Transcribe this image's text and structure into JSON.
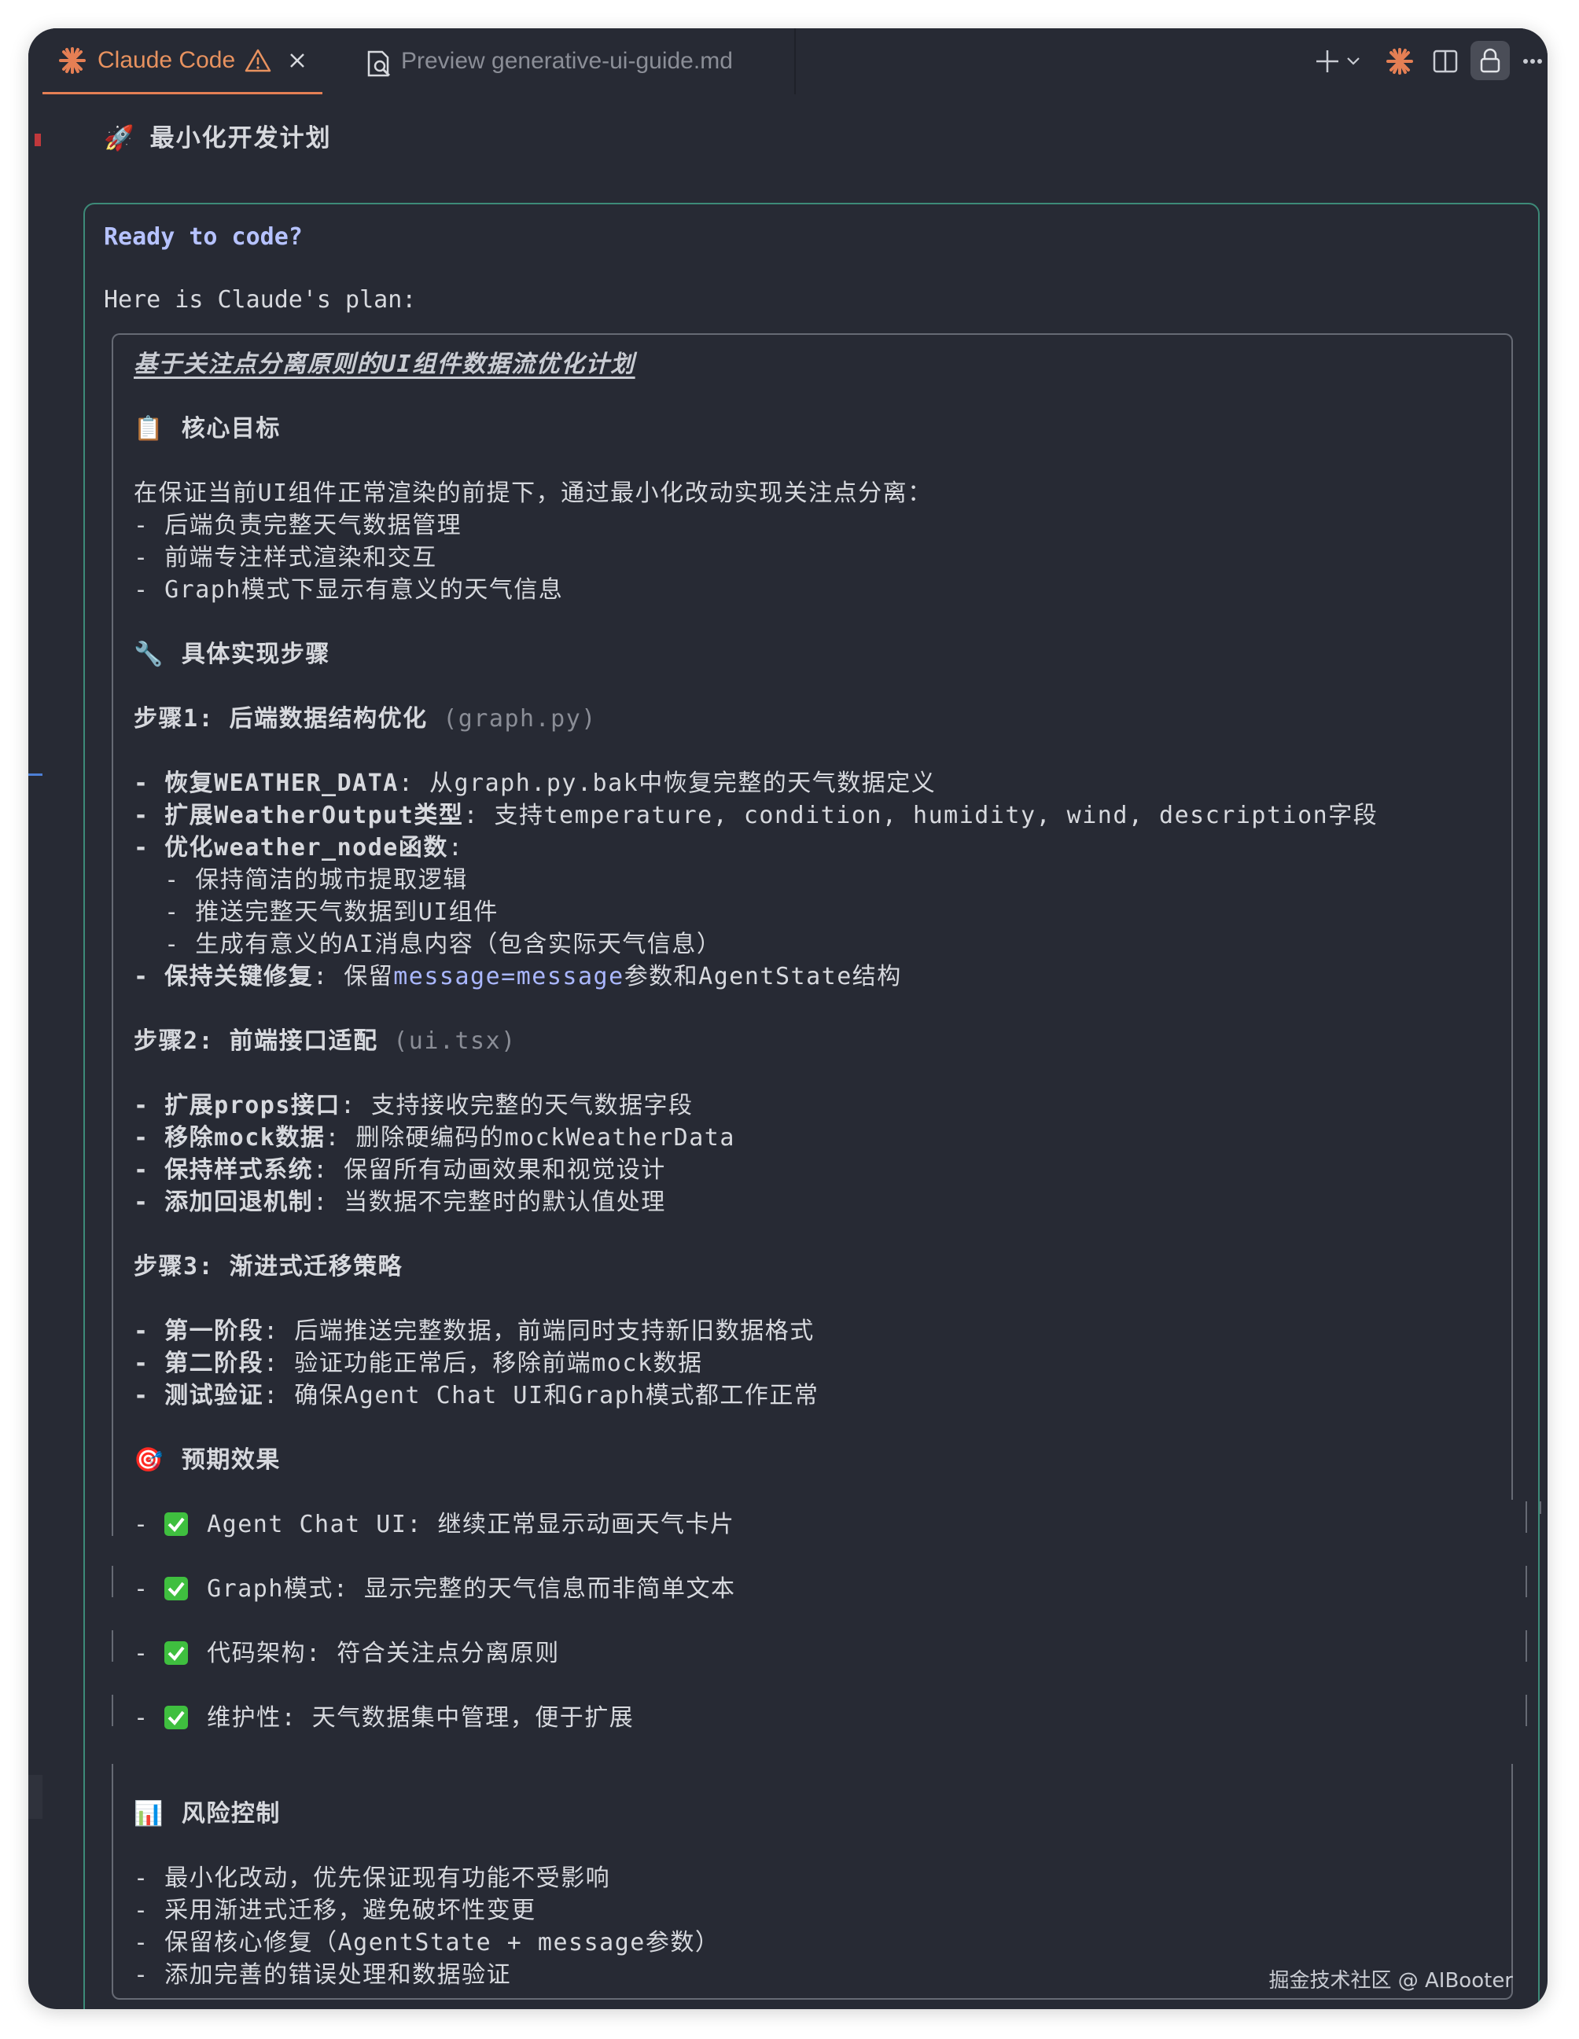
{
  "tabs": [
    {
      "label": "Claude Code",
      "icon": "claude-spark-icon",
      "warning_icon": "warning-icon",
      "close_icon": "close-icon"
    },
    {
      "label": "Preview generative-ui-guide.md",
      "icon": "markdown-preview-icon"
    }
  ],
  "toolbar": {
    "icons": [
      "plus-icon",
      "chevron-down-icon",
      "claude-spark-icon",
      "split-editor-icon",
      "lock-icon",
      "more-icon"
    ]
  },
  "header": {
    "emoji": "🚀",
    "title": "最小化开发计划"
  },
  "prompt": {
    "ready": "Ready to code?",
    "intro": "Here is Claude's plan:"
  },
  "plan": {
    "title": "基于关注点分离原则的UI组件数据流优化计划",
    "goal": {
      "emoji": "📋",
      "heading": "核心目标",
      "intro": "在保证当前UI组件正常渲染的前提下，通过最小化改动实现关注点分离：",
      "items": [
        "- 后端负责完整天气数据管理",
        "- 前端专注样式渲染和交互",
        "- Graph模式下显示有意义的天气信息"
      ]
    },
    "steps_heading": {
      "emoji": "🔧",
      "heading": "具体实现步骤"
    },
    "step1": {
      "title": "步骤1: 后端数据结构优化",
      "file": "(graph.py)",
      "items": [
        {
          "bold": "- 恢复WEATHER_DATA",
          "rest": ": 从graph.py.bak中恢复完整的天气数据定义"
        },
        {
          "bold": "- 扩展WeatherOutput类型",
          "rest": ": 支持temperature, condition, humidity, wind, description字段"
        },
        {
          "bold": "- 优化weather_node函数",
          "rest": ":"
        },
        {
          "bold": "",
          "rest": "  - 保持简洁的城市提取逻辑"
        },
        {
          "bold": "",
          "rest": "  - 推送完整天气数据到UI组件"
        },
        {
          "bold": "",
          "rest": "  - 生成有意义的AI消息内容（包含实际天气信息）"
        }
      ],
      "last_bold": "- 保持关键修复",
      "last_pre": ": 保留",
      "last_hl": "message=message",
      "last_post": "参数和AgentState结构"
    },
    "step2": {
      "title": "步骤2: 前端接口适配",
      "file": "(ui.tsx)",
      "items": [
        {
          "bold": "- 扩展props接口",
          "rest": ": 支持接收完整的天气数据字段"
        },
        {
          "bold": "- 移除mock数据",
          "rest": ": 删除硬编码的mockWeatherData"
        },
        {
          "bold": "- 保持样式系统",
          "rest": ": 保留所有动画效果和视觉设计"
        },
        {
          "bold": "- 添加回退机制",
          "rest": ": 当数据不完整时的默认值处理"
        }
      ]
    },
    "step3": {
      "title": "步骤3: 渐进式迁移策略",
      "items": [
        {
          "bold": "- 第一阶段",
          "rest": ": 后端推送完整数据，前端同时支持新旧数据格式"
        },
        {
          "bold": "- 第二阶段",
          "rest": ": 验证功能正常后，移除前端mock数据"
        },
        {
          "bold": "- 测试验证",
          "rest": ": 确保Agent Chat UI和Graph模式都工作正常"
        }
      ]
    },
    "effects": {
      "emoji": "🎯",
      "heading": "预期效果",
      "items": [
        "Agent Chat UI: 继续正常显示动画天气卡片",
        "Graph模式: 显示完整的天气信息而非简单文本",
        "代码架构: 符合关注点分离原则",
        "维护性: 天气数据集中管理，便于扩展"
      ]
    },
    "risk": {
      "emoji": "📊",
      "heading": "风险控制",
      "items": [
        "- 最小化改动，优先保证现有功能不受影响",
        "- 采用渐进式迁移，避免破坏性变更",
        "- 保留核心修复（AgentState + message参数）",
        "- 添加完善的错误处理和数据验证"
      ]
    }
  },
  "watermark": "掘金技术社区 @ AIBooter",
  "colors": {
    "background": "#272a34",
    "accent_orange": "#e57f54",
    "teal_border": "#3d8a78",
    "highlight_blue": "#aab7ff",
    "check_green": "#3fbf3f"
  }
}
